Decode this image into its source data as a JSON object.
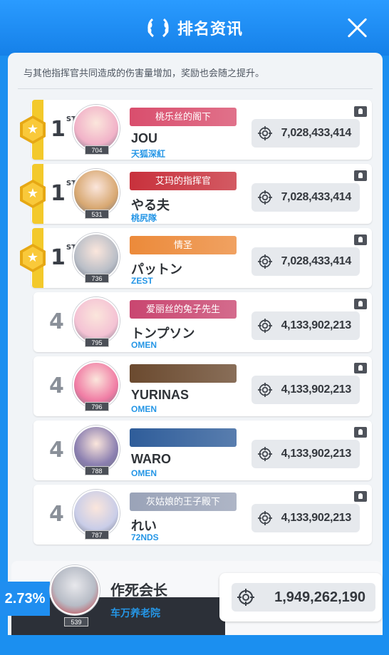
{
  "header": {
    "title": "排名资讯",
    "close_icon": "close-icon",
    "laurel_icon": "laurel-icon"
  },
  "description": "与其他指挥官共同造成的伤害量增加，奖励也会随之提升。",
  "colors": {
    "accent": "#1b8ff0",
    "gold": "#f3c92b",
    "union_blue": "#2596e6"
  },
  "rows": [
    {
      "rank": "1",
      "rank_suffix": "ST",
      "level": "704",
      "banner": "桃乐丝的阁下",
      "banner_color": "#d94e6d",
      "name": "JOU",
      "union": "天狐深紅",
      "score": "7,028,433,414",
      "avatar_color": "#f1b2c8"
    },
    {
      "rank": "1",
      "rank_suffix": "ST",
      "level": "531",
      "banner": "艾玛的指挥官",
      "banner_color": "#c8313c",
      "name": "やる夫",
      "union": "桃尻隊",
      "score": "7,028,433,414",
      "avatar_color": "#d8a872"
    },
    {
      "rank": "1",
      "rank_suffix": "ST",
      "level": "736",
      "banner": "情圣",
      "banner_color": "#ec8a3a",
      "name": "パットン",
      "union": "ZEST",
      "score": "7,028,433,414",
      "avatar_color": "#b9bec7"
    },
    {
      "rank": "4",
      "rank_suffix": "",
      "level": "795",
      "banner": "爱丽丝的兔子先生",
      "banner_color": "#c94670",
      "name": "トンプソン",
      "union": "OMEN",
      "score": "4,133,902,213",
      "avatar_color": "#f4c2d4"
    },
    {
      "rank": "4",
      "rank_suffix": "",
      "level": "796",
      "banner": "",
      "banner_color": "#6b4a2f",
      "name": "YURINAS",
      "union": "OMEN",
      "score": "4,133,902,213",
      "avatar_color": "#f07ca4"
    },
    {
      "rank": "4",
      "rank_suffix": "",
      "level": "788",
      "banner": "",
      "banner_color": "#2f5d9a",
      "name": "WARO",
      "union": "OMEN",
      "score": "4,133,902,213",
      "avatar_color": "#8b7fb0"
    },
    {
      "rank": "4",
      "rank_suffix": "",
      "level": "787",
      "banner": "灰姑娘的王子殿下",
      "banner_color": "#9aa3b8",
      "name": "れい",
      "union": "72NDS",
      "score": "4,133,902,213",
      "avatar_color": "#c9cde8"
    }
  ],
  "self": {
    "percent": "2.73%",
    "level": "539",
    "name": "作死会长",
    "union": "车万养老院",
    "score": "1,949,262,190"
  }
}
